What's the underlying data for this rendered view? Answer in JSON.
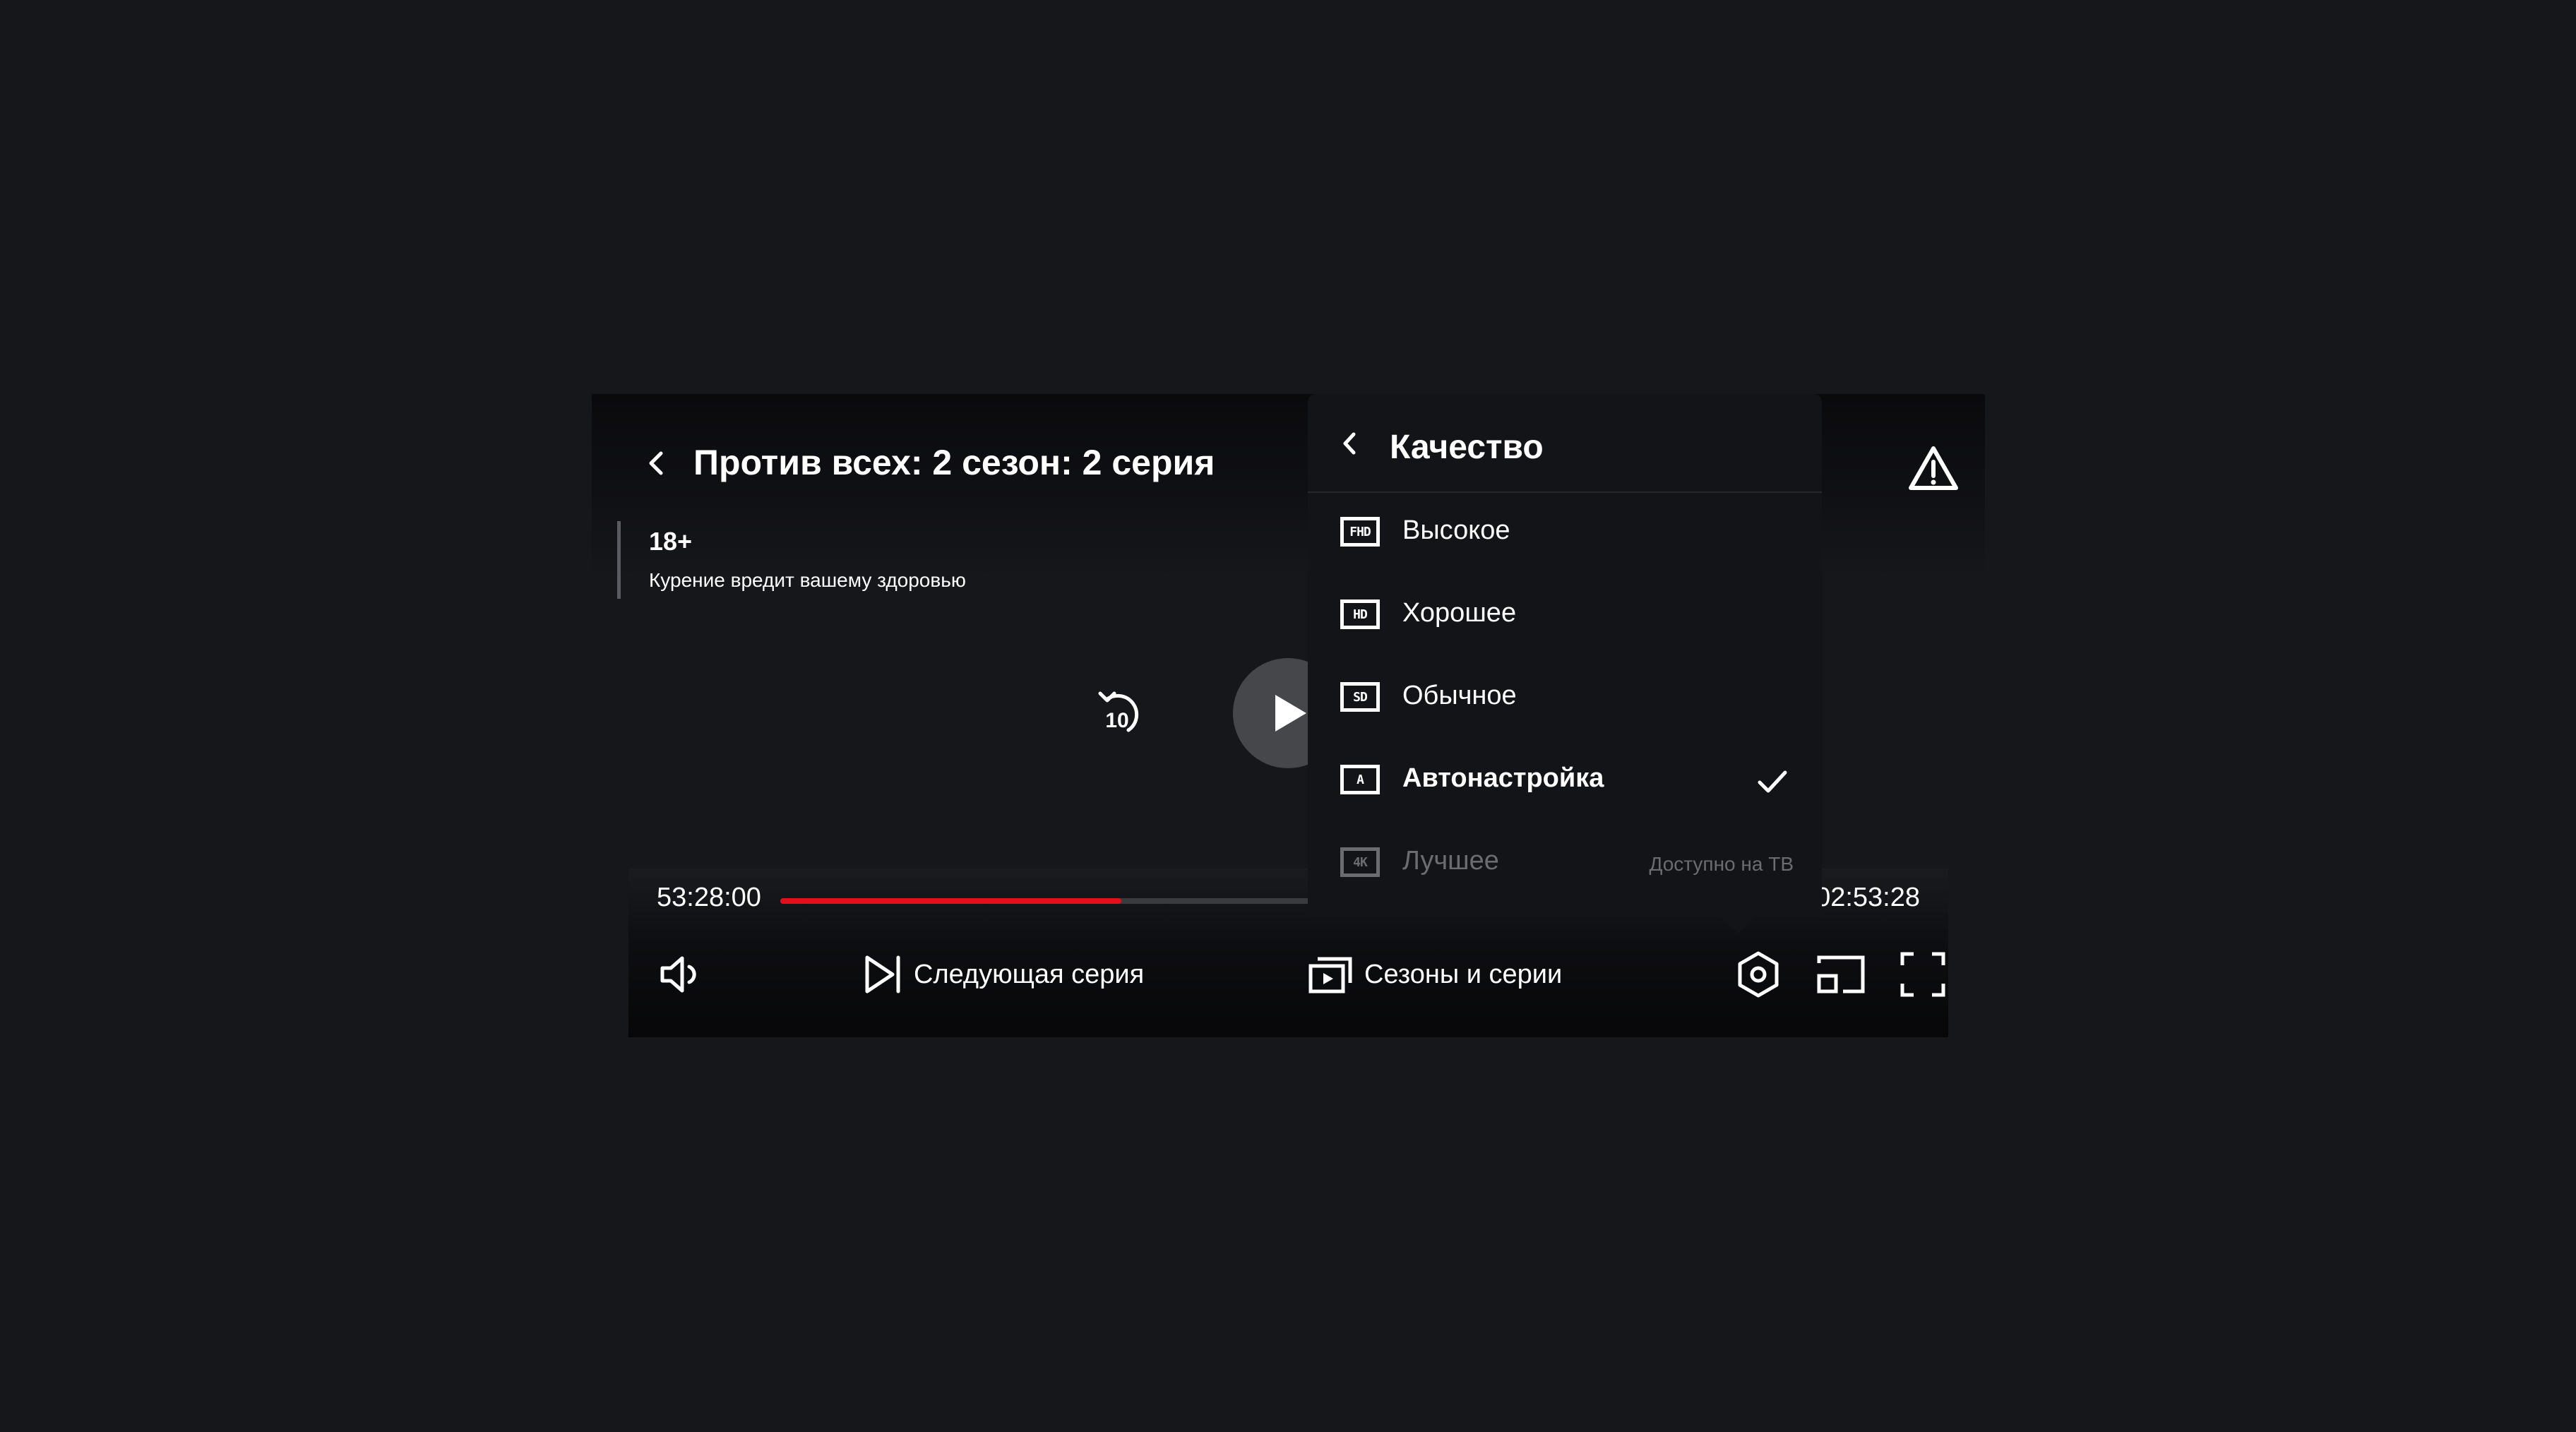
{
  "player": {
    "title": "Против всех: 2 сезон: 2 серия",
    "rating": {
      "age": "18+",
      "note": "Курение вредит вашему здоровью"
    },
    "icons": {
      "back": "chevron-left-icon",
      "warning": "warning-triangle-icon",
      "rewind": "rewind-10-icon",
      "play": "play-icon"
    },
    "rewind_seconds": "10"
  },
  "timeline": {
    "current": "53:28:00",
    "total": "02:53:28",
    "progress": 0.345,
    "accent_color": "#e3101c"
  },
  "controls": {
    "volume": "volume-icon",
    "next_episode_label": "Следующая серия",
    "seasons_label": "Сезоны и серии",
    "settings": "settings-hexagon-icon",
    "cast": "cast-icon",
    "fullscreen": "fullscreen-icon"
  },
  "quality_menu": {
    "title": "Качество",
    "items": [
      {
        "badge": "FHD",
        "label": "Высокое",
        "selected": false,
        "disabled": false,
        "note": ""
      },
      {
        "badge": "HD",
        "label": "Хорошее",
        "selected": false,
        "disabled": false,
        "note": ""
      },
      {
        "badge": "SD",
        "label": "Обычное",
        "selected": false,
        "disabled": false,
        "note": ""
      },
      {
        "badge": "A",
        "label": "Автонастройка",
        "selected": true,
        "disabled": false,
        "note": ""
      },
      {
        "badge": "4K",
        "label": "Лучшее",
        "selected": false,
        "disabled": true,
        "note": "Доступно на ТВ"
      }
    ]
  }
}
